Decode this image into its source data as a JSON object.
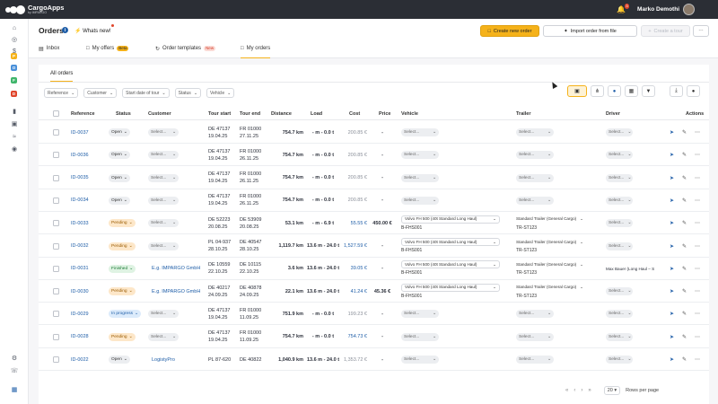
{
  "app": {
    "name": "CargoApps",
    "sub": "by IMPARGO",
    "notifications": "3",
    "user_name": "Marko Demothi"
  },
  "sidebar": {
    "dots": [
      {
        "letter": "P",
        "color": "#f5b21a"
      },
      {
        "letter": "O",
        "color": "#4a90d9"
      },
      {
        "letter": "F",
        "color": "#3fb56b"
      },
      {
        "letter": "D",
        "color": "#e0452b"
      }
    ]
  },
  "header": {
    "title": "Orders",
    "whats_new": "Whats new!",
    "create_order": "Create new order",
    "import_order": "Import order from file",
    "create_tour": "Create a tour"
  },
  "tabs": [
    {
      "label": "Inbox",
      "badge": ""
    },
    {
      "label": "My offers",
      "badge": "Beta"
    },
    {
      "label": "Order templates",
      "badge": "New"
    },
    {
      "label": "My orders",
      "badge": ""
    }
  ],
  "subtab": "All orders",
  "filters": [
    "Reference",
    "Customer",
    "Start date of tour",
    "Status",
    "Vehicle"
  ],
  "columns": [
    "Reference",
    "Status",
    "Customer",
    "Tour start",
    "Tour end",
    "Distance",
    "Load",
    "Cost",
    "Price",
    "Vehicle",
    "Trailer",
    "Driver",
    "Actions"
  ],
  "rows": [
    {
      "ref": "ID-0037",
      "status": "Open",
      "status_class": "st-open",
      "customer": "Select...",
      "customer_link": false,
      "start1": "DE 47137",
      "start2": "19.04.25",
      "end1": "FR 01000",
      "end2": "27.11.25",
      "distance": "754.7 km",
      "load": "- m - 0.0 t",
      "cost": "200.85 €",
      "cost_class": "cost-grey",
      "price": "-",
      "vehicle": "Select...",
      "vehicle_plate": "",
      "trailer": "Select...",
      "trailer_plate": "",
      "driver": "Select..."
    },
    {
      "ref": "ID-0036",
      "status": "Open",
      "status_class": "st-open",
      "customer": "Select...",
      "customer_link": false,
      "start1": "DE 47137",
      "start2": "19.04.25",
      "end1": "FR 01000",
      "end2": "26.11.25",
      "distance": "754.7 km",
      "load": "- m - 0.0 t",
      "cost": "200.85 €",
      "cost_class": "cost-grey",
      "price": "-",
      "vehicle": "Select...",
      "vehicle_plate": "",
      "trailer": "Select...",
      "trailer_plate": "",
      "driver": "Select..."
    },
    {
      "ref": "ID-0035",
      "status": "Open",
      "status_class": "st-open",
      "customer": "Select...",
      "customer_link": false,
      "start1": "DE 47137",
      "start2": "19.04.25",
      "end1": "FR 01000",
      "end2": "26.11.25",
      "distance": "754.7 km",
      "load": "- m - 0.0 t",
      "cost": "200.85 €",
      "cost_class": "cost-grey",
      "price": "-",
      "vehicle": "Select...",
      "vehicle_plate": "",
      "trailer": "Select...",
      "trailer_plate": "",
      "driver": "Select..."
    },
    {
      "ref": "ID-0034",
      "status": "Open",
      "status_class": "st-open",
      "customer": "Select...",
      "customer_link": false,
      "start1": "DE 47137",
      "start2": "19.04.25",
      "end1": "FR 01000",
      "end2": "26.11.25",
      "distance": "754.7 km",
      "load": "- m - 0.0 t",
      "cost": "200.85 €",
      "cost_class": "cost-grey",
      "price": "-",
      "vehicle": "Select...",
      "vehicle_plate": "",
      "trailer": "Select...",
      "trailer_plate": "",
      "driver": "Select..."
    },
    {
      "ref": "ID-0033",
      "status": "Pending",
      "status_class": "st-pending",
      "customer": "Select...",
      "customer_link": false,
      "start1": "DE 52223",
      "start2": "20.08.25",
      "end1": "DE 53909",
      "end2": "20.08.25",
      "distance": "53.1 km",
      "load": "- m - 6.9 t",
      "cost": "55.55 €",
      "cost_class": "cost-blue",
      "price": "450.00 €",
      "vehicle": "Volvo FH 500 (40t Standard Long Haul)",
      "vehicle_plate": "B-FHS001",
      "trailer": "Standard Trailer (General Cargo)",
      "trailer_plate": "TR-ST123",
      "driver": "Select..."
    },
    {
      "ref": "ID-0032",
      "status": "Pending",
      "status_class": "st-pending",
      "customer": "Select...",
      "customer_link": false,
      "start1": "PL 04-937",
      "start2": "28.10.25",
      "end1": "DE 40547",
      "end2": "28.10.25",
      "distance": "1,119.7 km",
      "load": "13.6 m - 24.0 t",
      "cost": "1,527.59 €",
      "cost_class": "cost-blue",
      "price": "-",
      "vehicle": "Volvo FH 500 (40t Standard Long Haul)",
      "vehicle_plate": "B-FHS001",
      "trailer": "Standard Trailer (General Cargo)",
      "trailer_plate": "TR-ST123",
      "driver": "Select..."
    },
    {
      "ref": "ID-0031",
      "status": "Finished",
      "status_class": "st-finished",
      "customer": "E.g. IMPARGO GmbH",
      "customer_link": true,
      "start1": "DE 10559",
      "start2": "22.10.25",
      "end1": "DE 10115",
      "end2": "22.10.25",
      "distance": "3.6 km",
      "load": "13.6 m - 24.0 t",
      "cost": "39.05 €",
      "cost_class": "cost-blue",
      "price": "-",
      "vehicle": "Volvo FH 500 (40t Standard Long Haul)",
      "vehicle_plate": "B-FHS001",
      "trailer": "Standard Trailer (General Cargo)",
      "trailer_plate": "TR-ST123",
      "driver": "Max Bauer (Long Haul – S"
    },
    {
      "ref": "ID-0030",
      "status": "Pending",
      "status_class": "st-pending",
      "customer": "E.g. IMPARGO GmbH",
      "customer_link": true,
      "start1": "DE 40217",
      "start2": "24.09.25",
      "end1": "DE 40878",
      "end2": "24.09.25",
      "distance": "22.1 km",
      "load": "13.6 m - 24.0 t",
      "cost": "41.24 €",
      "cost_class": "cost-blue",
      "price": "45.36 €",
      "vehicle": "Volvo FH 500 (40t Standard Long Haul)",
      "vehicle_plate": "B-FHS001",
      "trailer": "Standard Trailer (General Cargo)",
      "trailer_plate": "TR-ST123",
      "driver": "Select..."
    },
    {
      "ref": "ID-0029",
      "status": "In progress",
      "status_class": "st-progress",
      "customer": "Select...",
      "customer_link": false,
      "start1": "DE 47137",
      "start2": "19.04.25",
      "end1": "FR 01000",
      "end2": "11.09.25",
      "distance": "751.9 km",
      "load": "- m - 0.0 t",
      "cost": "199.23 €",
      "cost_class": "cost-grey",
      "price": "-",
      "vehicle": "Select...",
      "vehicle_plate": "",
      "trailer": "Select...",
      "trailer_plate": "",
      "driver": "Select..."
    },
    {
      "ref": "ID-0028",
      "status": "Pending",
      "status_class": "st-pending",
      "customer": "Select...",
      "customer_link": false,
      "start1": "DE 47137",
      "start2": "19.04.25",
      "end1": "FR 01000",
      "end2": "11.09.25",
      "distance": "754.7 km",
      "load": "- m - 0.0 t",
      "cost": "754.73 €",
      "cost_class": "cost-blue",
      "price": "-",
      "vehicle": "Select...",
      "vehicle_plate": "",
      "trailer": "Select...",
      "trailer_plate": "",
      "driver": "Select..."
    },
    {
      "ref": "ID-0022",
      "status": "Open",
      "status_class": "st-open",
      "customer": "LogistyPro",
      "customer_link": true,
      "start1": "PL 87-620",
      "start2": "",
      "end1": "DE 40822",
      "end2": "",
      "distance": "1,040.9 km",
      "load": "13.6 m - 24.0 t",
      "cost": "1,353.72 €",
      "cost_class": "cost-grey",
      "price": "-",
      "vehicle": "Select...",
      "vehicle_plate": "",
      "trailer": "Select...",
      "trailer_plate": "",
      "driver": "Select..."
    }
  ],
  "pagination": {
    "per_page": "20",
    "per_page_label": "Rows per page"
  }
}
